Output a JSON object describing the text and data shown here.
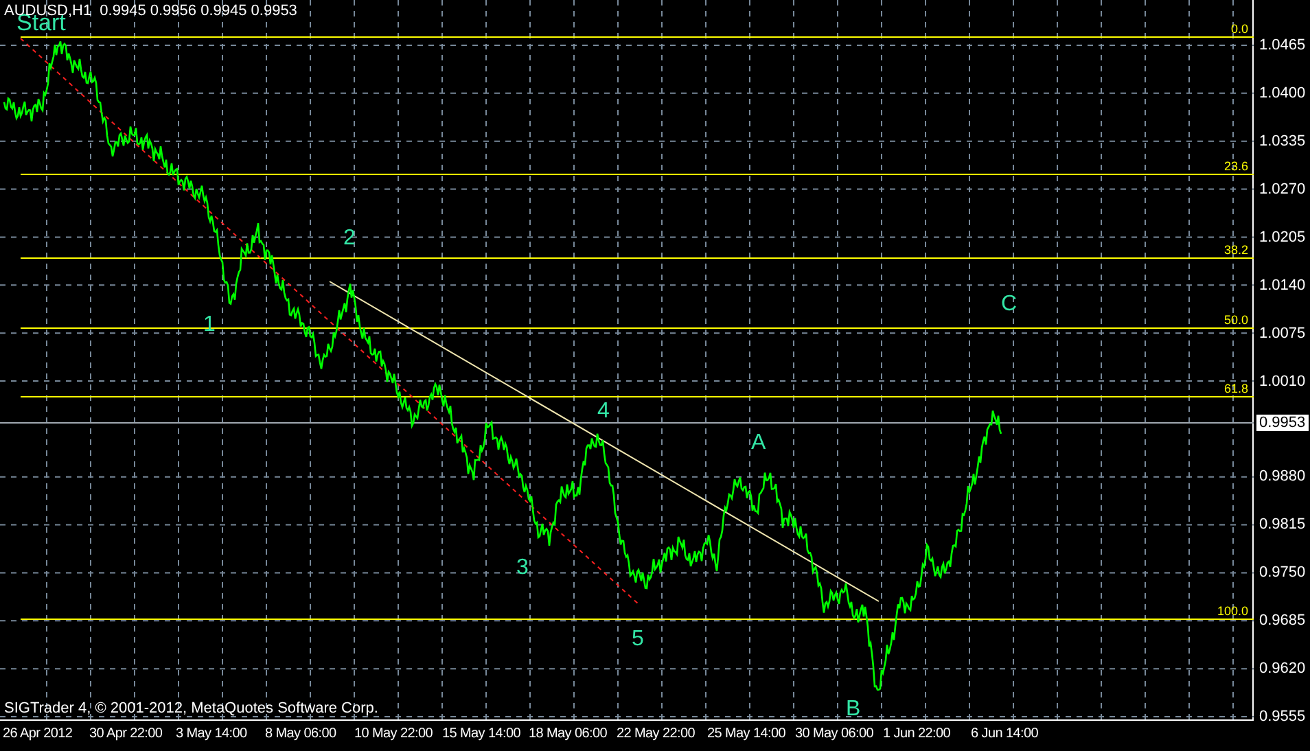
{
  "header": "AUDUSD,H1  0.9945 0.9956 0.9945 0.9953",
  "copyright": "SIGTrader 4, © 2001-2012, MetaQuotes Software Corp.",
  "price_axis": {
    "ticks": [
      "1.0465",
      "1.0400",
      "1.0335",
      "1.0270",
      "1.0205",
      "1.0140",
      "1.0075",
      "1.0010",
      "0.9880",
      "0.9815",
      "0.9750",
      "0.9685",
      "0.9620",
      "0.9555"
    ],
    "current_price": "0.9953"
  },
  "fibonacci_levels": [
    {
      "label": "0.0"
    },
    {
      "label": "23.6"
    },
    {
      "label": "38.2"
    },
    {
      "label": "50.0"
    },
    {
      "label": "61.8"
    },
    {
      "label": "100.0"
    }
  ],
  "wave_labels": [
    {
      "label": "Start"
    },
    {
      "label": "1"
    },
    {
      "label": "2"
    },
    {
      "label": "3"
    },
    {
      "label": "4"
    },
    {
      "label": "5"
    },
    {
      "label": "A"
    },
    {
      "label": "B"
    },
    {
      "label": "C"
    }
  ],
  "time_axis": {
    "ticks": [
      "26 Apr 2012",
      "30 Apr 22:00",
      "3 May 14:00",
      "8 May 06:00",
      "10 May 22:00",
      "15 May 14:00",
      "18 May 06:00",
      "22 May 22:00",
      "25 May 14:00",
      "30 May 06:00",
      "1 Jun 22:00",
      "6 Jun 14:00"
    ]
  }
}
